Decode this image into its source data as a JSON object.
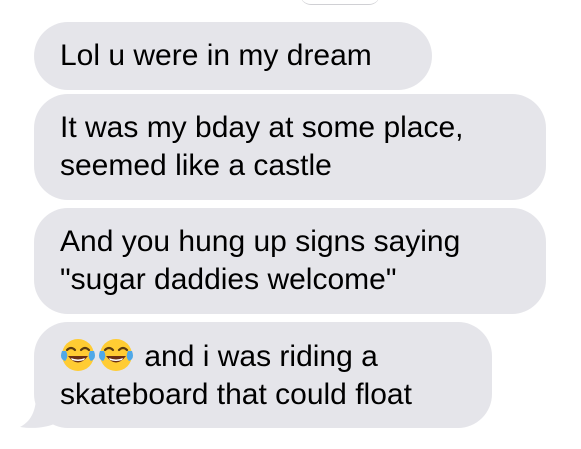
{
  "messages": [
    {
      "lines": [
        "Lol u were in my dream"
      ]
    },
    {
      "lines": [
        "It was my bday at some place,",
        "seemed like a castle"
      ]
    },
    {
      "lines": [
        "And you hung up signs saying",
        "\"sugar daddies welcome\""
      ]
    },
    {
      "emoji": [
        "face-with-tears-of-joy",
        "face-with-tears-of-joy"
      ],
      "lines": [
        "and i was riding a",
        "skateboard that could float"
      ]
    }
  ],
  "colors": {
    "bubble": "#e5e5ea",
    "text": "#000000",
    "emoji_face": "#ffcc33",
    "emoji_tears": "#4fa8e8"
  }
}
